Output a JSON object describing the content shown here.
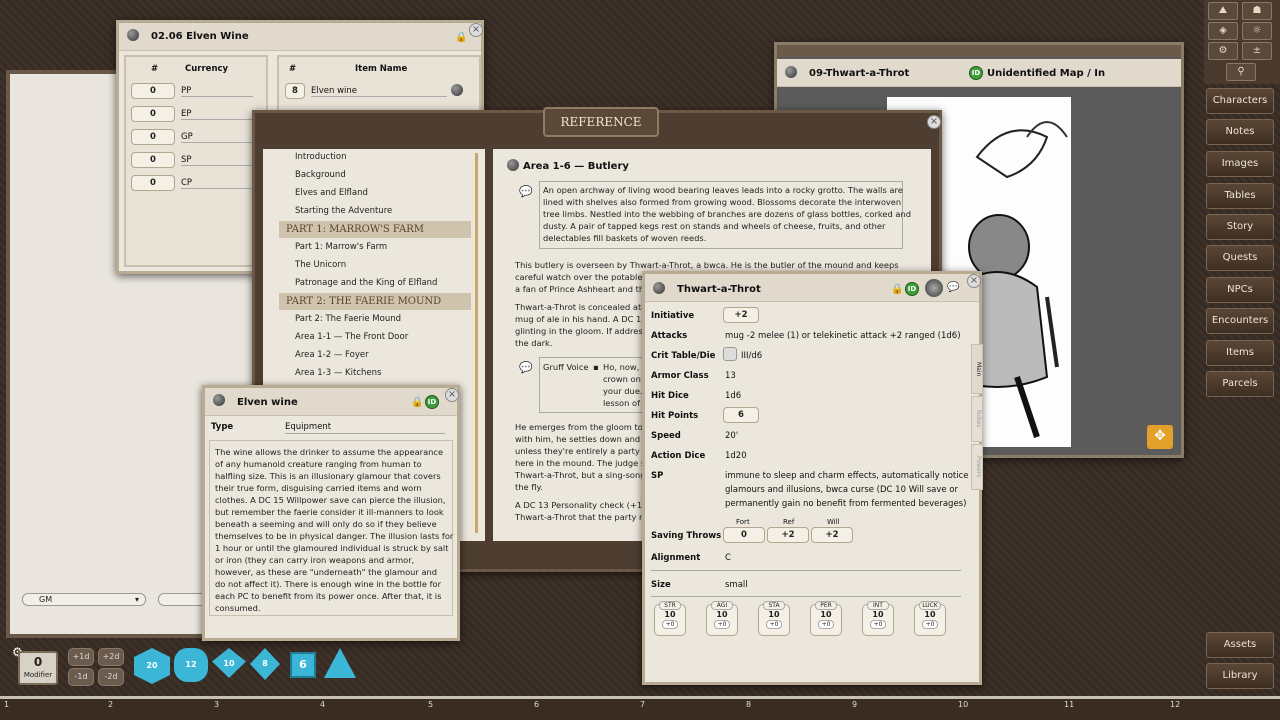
{
  "inventory": {
    "title": "02.06 Elven Wine",
    "currency_header": [
      "#",
      "Currency"
    ],
    "currencies": [
      {
        "count": "0",
        "name": "PP"
      },
      {
        "count": "0",
        "name": "EP"
      },
      {
        "count": "0",
        "name": "GP"
      },
      {
        "count": "0",
        "name": "SP"
      },
      {
        "count": "0",
        "name": "CP"
      }
    ],
    "item_header": [
      "#",
      "Item Name"
    ],
    "items": [
      {
        "count": "8",
        "name": "Elven wine"
      }
    ]
  },
  "reference": {
    "title": "REFERENCE",
    "toc": [
      "Introduction",
      "Background",
      "Elves and Elfland",
      "Starting the Adventure",
      "Part 1: Marrow's Farm",
      "The Unicorn",
      "Patronage and the King of Elfland",
      "Part 2: The Faerie Mound",
      "Area 1-1 — The Front Door",
      "Area 1-2 — Foyer",
      "Area 1-3 — Kitchens"
    ],
    "part_headers": [
      "PART 1: MARROW'S FARM",
      "PART 2: THE FAERIE MOUND"
    ],
    "area_title": "Area 1-6 — Butlery",
    "read_aloud": [
      "An open archway of living wood bearing leaves leads into a rocky grotto. The walls are",
      "lined with shelves also formed from growing wood. Blossoms decorate the interwoven",
      "tree limbs. Nestled into the webbing of branches are dozens of glass bottles, corked and",
      "dusty. A pair of tapped kegs rest on stands and wheels of cheese, fruits, and other",
      "delectables fill baskets of woven reeds."
    ],
    "para1": [
      "This butlery is overseen by Thwart-a-Throt, a bwca. He is the butler of the mound and keeps",
      "careful watch over the potables",
      "a fan of Prince Ashheart and the"
    ],
    "para2": [
      "Thwart-a-Throt is concealed atop",
      "mug of ale in his hand. A DC 15 I",
      "glinting in the gloom. If addresse",
      "the dark."
    ],
    "gruff_label": "Gruff Voice",
    "gruff_lines": [
      "Ho, now, th",
      "crown on y",
      "your due. T",
      "lesson of y"
    ],
    "para3": [
      "He emerges from the gloom to s",
      "with him, he settles down and lo",
      "unless they're entirely a party of",
      "here in the mound. The judge sh",
      "Thwart-a-Throt, but a sing-song",
      "the fly."
    ],
    "para4": [
      "A DC 13 Personality check (+1d m",
      "Thwart-a-Throt that the party m"
    ]
  },
  "elven_wine": {
    "title": "Elven wine",
    "type_label": "Type",
    "type_value": "Equipment",
    "description": [
      "The wine allows the drinker to assume the appearance",
      "of any humanoid creature ranging from human to",
      "halfling size. This is an illusionary glamour that covers",
      "their true form, disguising carried items and worn",
      "clothes. A DC 15 Willpower save can pierce the illusion,",
      "but remember the faerie consider it ill-manners to look",
      "beneath a seeming and will only do so if they believe",
      "themselves to be in physical danger. The illusion lasts for",
      "1 hour or until the glamoured individual is struck by salt",
      "or iron (they can carry iron weapons and armor,",
      "however, as these are \"underneath\" the glamour and",
      "do not affect it). There is enough wine in the bottle for",
      "each PC to benefit from its power once. After that, it is",
      "consumed."
    ]
  },
  "npc": {
    "title": "Thwart-a-Throt",
    "tabs": [
      "Main",
      "Notes",
      "Powers"
    ],
    "initiative_label": "Initiative",
    "initiative": "+2",
    "attacks_label": "Attacks",
    "attacks": "mug -2 melee (1) or telekinetic attack +2 ranged (1d6)",
    "crit_label": "Crit Table/Die",
    "crit": "III/d6",
    "ac_label": "Armor Class",
    "ac": "13",
    "hd_label": "Hit Dice",
    "hd": "1d6",
    "hp_label": "Hit Points",
    "hp": "6",
    "speed_label": "Speed",
    "speed": "20'",
    "action_label": "Action Dice",
    "action": "1d20",
    "sp_label": "SP",
    "sp": [
      "immune to sleep and charm effects, automatically notice",
      "glamours and illusions, bwca curse (DC 10 Will save or",
      "permanently gain no benefit from fermented beverages)"
    ],
    "saves_label": "Saving Throws",
    "saves": [
      {
        "name": "Fort",
        "value": "0"
      },
      {
        "name": "Ref",
        "value": "+2"
      },
      {
        "name": "Will",
        "value": "+2"
      }
    ],
    "align_label": "Alignment",
    "align": "C",
    "size_label": "Size",
    "size": "small",
    "stats": [
      {
        "name": "STR",
        "value": "10",
        "mod": "+0"
      },
      {
        "name": "AGI",
        "value": "10",
        "mod": "+0"
      },
      {
        "name": "STA",
        "value": "10",
        "mod": "+0"
      },
      {
        "name": "PER",
        "value": "10",
        "mod": "+0"
      },
      {
        "name": "INT",
        "value": "10",
        "mod": "+0"
      },
      {
        "name": "LUCK",
        "value": "10",
        "mod": "+0"
      }
    ]
  },
  "image_window": {
    "title": "09-Thwart-a-Throt",
    "subtitle": "Unidentified Map / In"
  },
  "sidebar": [
    "Characters",
    "Notes",
    "Images",
    "Tables",
    "Story",
    "Quests",
    "NPCs",
    "Encounters",
    "Items",
    "Parcels"
  ],
  "sidebar_bottom": [
    "Assets",
    "Library"
  ],
  "chat": {
    "identity": "GM"
  },
  "modifier": {
    "value": "0",
    "label": "Modifier"
  },
  "mod_buttons": [
    "+1d",
    "+2d",
    "-1d",
    "-2d"
  ],
  "dice": [
    "20",
    "12",
    "10",
    "8",
    "6"
  ],
  "hotbar": [
    "1",
    "2",
    "3",
    "4",
    "5",
    "6",
    "7",
    "8",
    "9",
    "10",
    "11",
    "12"
  ],
  "colors": {
    "accent": "#3bb6d6",
    "leather": "#3d3129",
    "paper": "#ece7dd"
  }
}
